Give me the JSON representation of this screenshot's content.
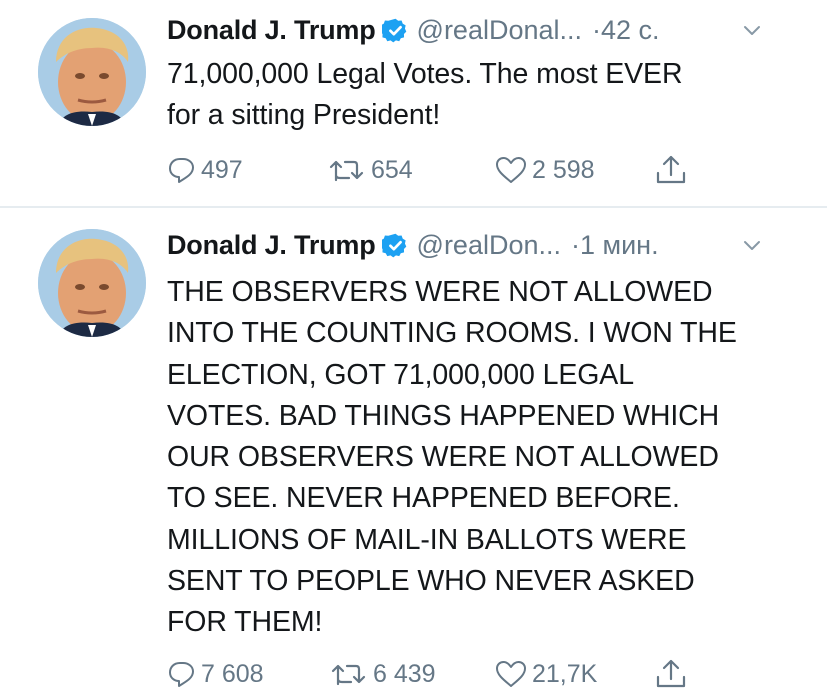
{
  "colors": {
    "text": "#14171a",
    "secondary": "#657786",
    "verified": "#1da1f2",
    "divider": "#e6ecf0"
  },
  "tweets": [
    {
      "author": {
        "name": "Donald J. Trump",
        "handle": "@realDonal...",
        "verified_icon": "verified-badge-icon"
      },
      "separator": "·",
      "time": "42 с.",
      "text": "71,000,000 Legal Votes. The most EVER\nfor a sitting President!",
      "stats": {
        "replies": "497",
        "retweets": "654",
        "likes": "2 598"
      }
    },
    {
      "author": {
        "name": "Donald J. Trump",
        "handle": "@realDon...",
        "verified_icon": "verified-badge-icon"
      },
      "separator": "·",
      "time": "1 мин.",
      "text": "THE OBSERVERS WERE NOT ALLOWED\nINTO THE COUNTING ROOMS. I WON THE\nELECTION, GOT 71,000,000 LEGAL\nVOTES. BAD THINGS HAPPENED WHICH\nOUR OBSERVERS WERE NOT ALLOWED\nTO SEE. NEVER HAPPENED BEFORE.\nMILLIONS OF MAIL-IN BALLOTS WERE\nSENT TO PEOPLE WHO NEVER ASKED\nFOR THEM!",
      "stats": {
        "replies": "7 608",
        "retweets": "6 439",
        "likes": "21,7K"
      }
    }
  ]
}
